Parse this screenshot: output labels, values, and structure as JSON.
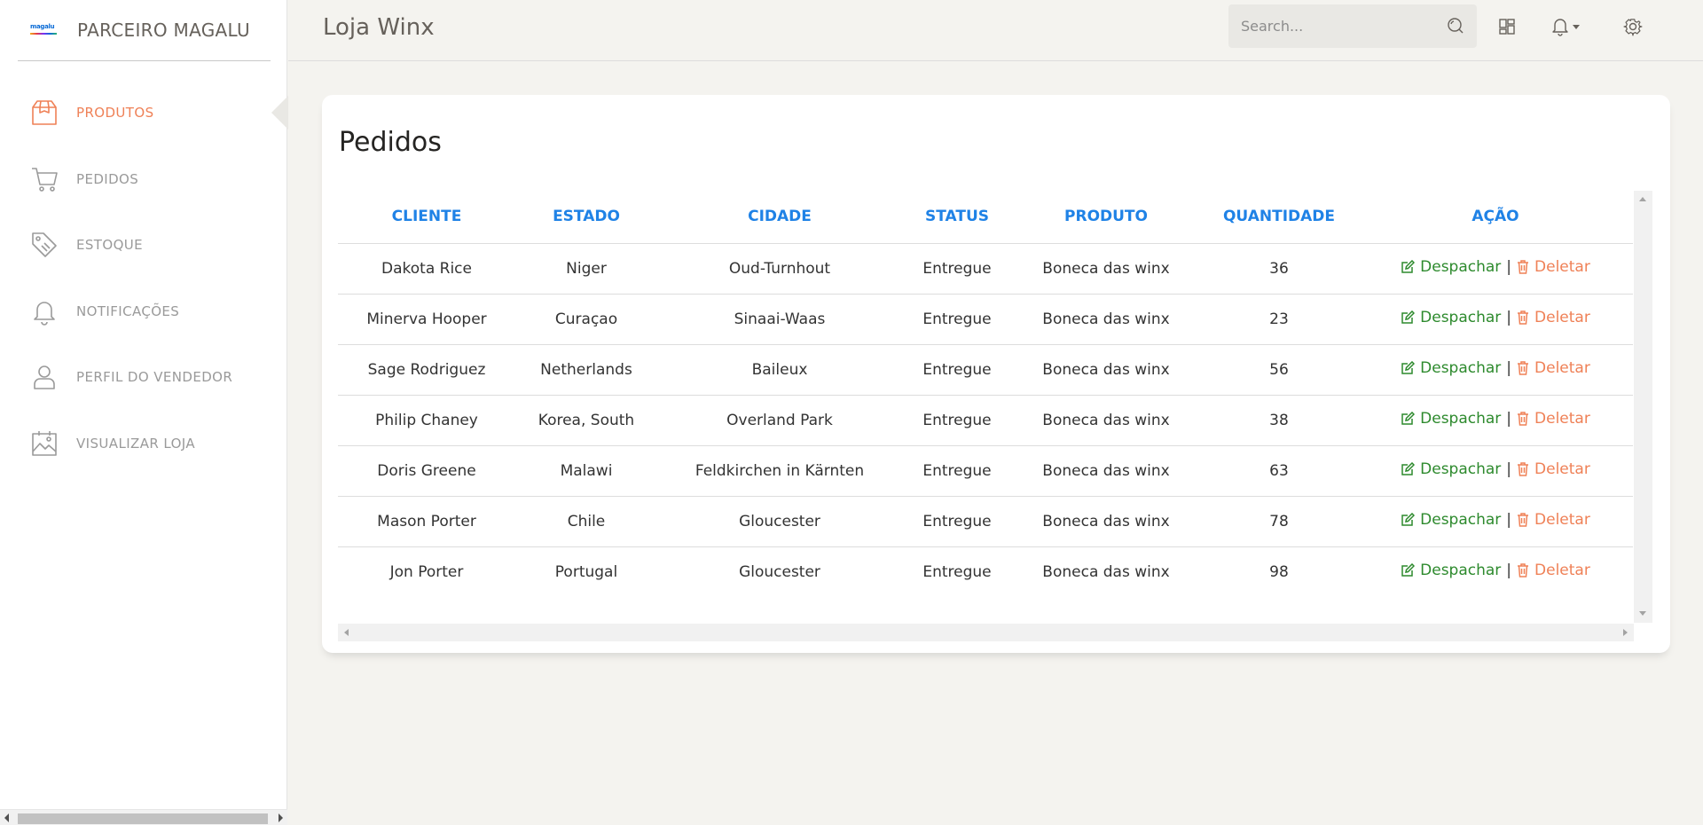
{
  "brand": {
    "logo_text": "magalu",
    "name": "PARCEIRO MAGALU"
  },
  "sidebar": {
    "items": [
      {
        "label": "PRODUTOS",
        "icon": "box-icon",
        "active": true
      },
      {
        "label": "PEDIDOS",
        "icon": "cart-icon",
        "active": false
      },
      {
        "label": "ESTOQUE",
        "icon": "tags-icon",
        "active": false
      },
      {
        "label": "NOTIFICAÇÕES",
        "icon": "bell-icon",
        "active": false
      },
      {
        "label": "PERFIL DO VENDEDOR",
        "icon": "user-icon",
        "active": false
      },
      {
        "label": "VISUALIZAR LOJA",
        "icon": "image-icon",
        "active": false
      }
    ]
  },
  "header": {
    "title": "Loja Winx",
    "search_placeholder": "Search...",
    "icons": [
      "search-icon",
      "dashboard-icon",
      "bell-icon",
      "caret-down-icon",
      "gear-icon"
    ]
  },
  "card": {
    "title": "Pedidos",
    "columns": [
      "CLIENTE",
      "ESTADO",
      "CIDADE",
      "STATUS",
      "PRODUTO",
      "QUANTIDADE",
      "AÇÃO"
    ],
    "action_edit": "Despachar",
    "action_sep": "|",
    "action_delete": "Deletar",
    "rows": [
      {
        "cliente": "Dakota Rice",
        "estado": "Niger",
        "cidade": "Oud-Turnhout",
        "status": "Entregue",
        "produto": "Boneca das winx",
        "quantidade": "36"
      },
      {
        "cliente": "Minerva Hooper",
        "estado": "Curaçao",
        "cidade": "Sinaai-Waas",
        "status": "Entregue",
        "produto": "Boneca das winx",
        "quantidade": "23"
      },
      {
        "cliente": "Sage Rodriguez",
        "estado": "Netherlands",
        "cidade": "Baileux",
        "status": "Entregue",
        "produto": "Boneca das winx",
        "quantidade": "56"
      },
      {
        "cliente": "Philip Chaney",
        "estado": "Korea, South",
        "cidade": "Overland Park",
        "status": "Entregue",
        "produto": "Boneca das winx",
        "quantidade": "38"
      },
      {
        "cliente": "Doris Greene",
        "estado": "Malawi",
        "cidade": "Feldkirchen in Kärnten",
        "status": "Entregue",
        "produto": "Boneca das winx",
        "quantidade": "63"
      },
      {
        "cliente": "Mason Porter",
        "estado": "Chile",
        "cidade": "Gloucester",
        "status": "Entregue",
        "produto": "Boneca das winx",
        "quantidade": "78"
      },
      {
        "cliente": "Jon Porter",
        "estado": "Portugal",
        "cidade": "Gloucester",
        "status": "Entregue",
        "produto": "Boneca das winx",
        "quantidade": "98"
      }
    ]
  },
  "colors": {
    "accent": "#ef8157",
    "header_blue": "#1f82e6",
    "success": "#2d8a2d"
  }
}
